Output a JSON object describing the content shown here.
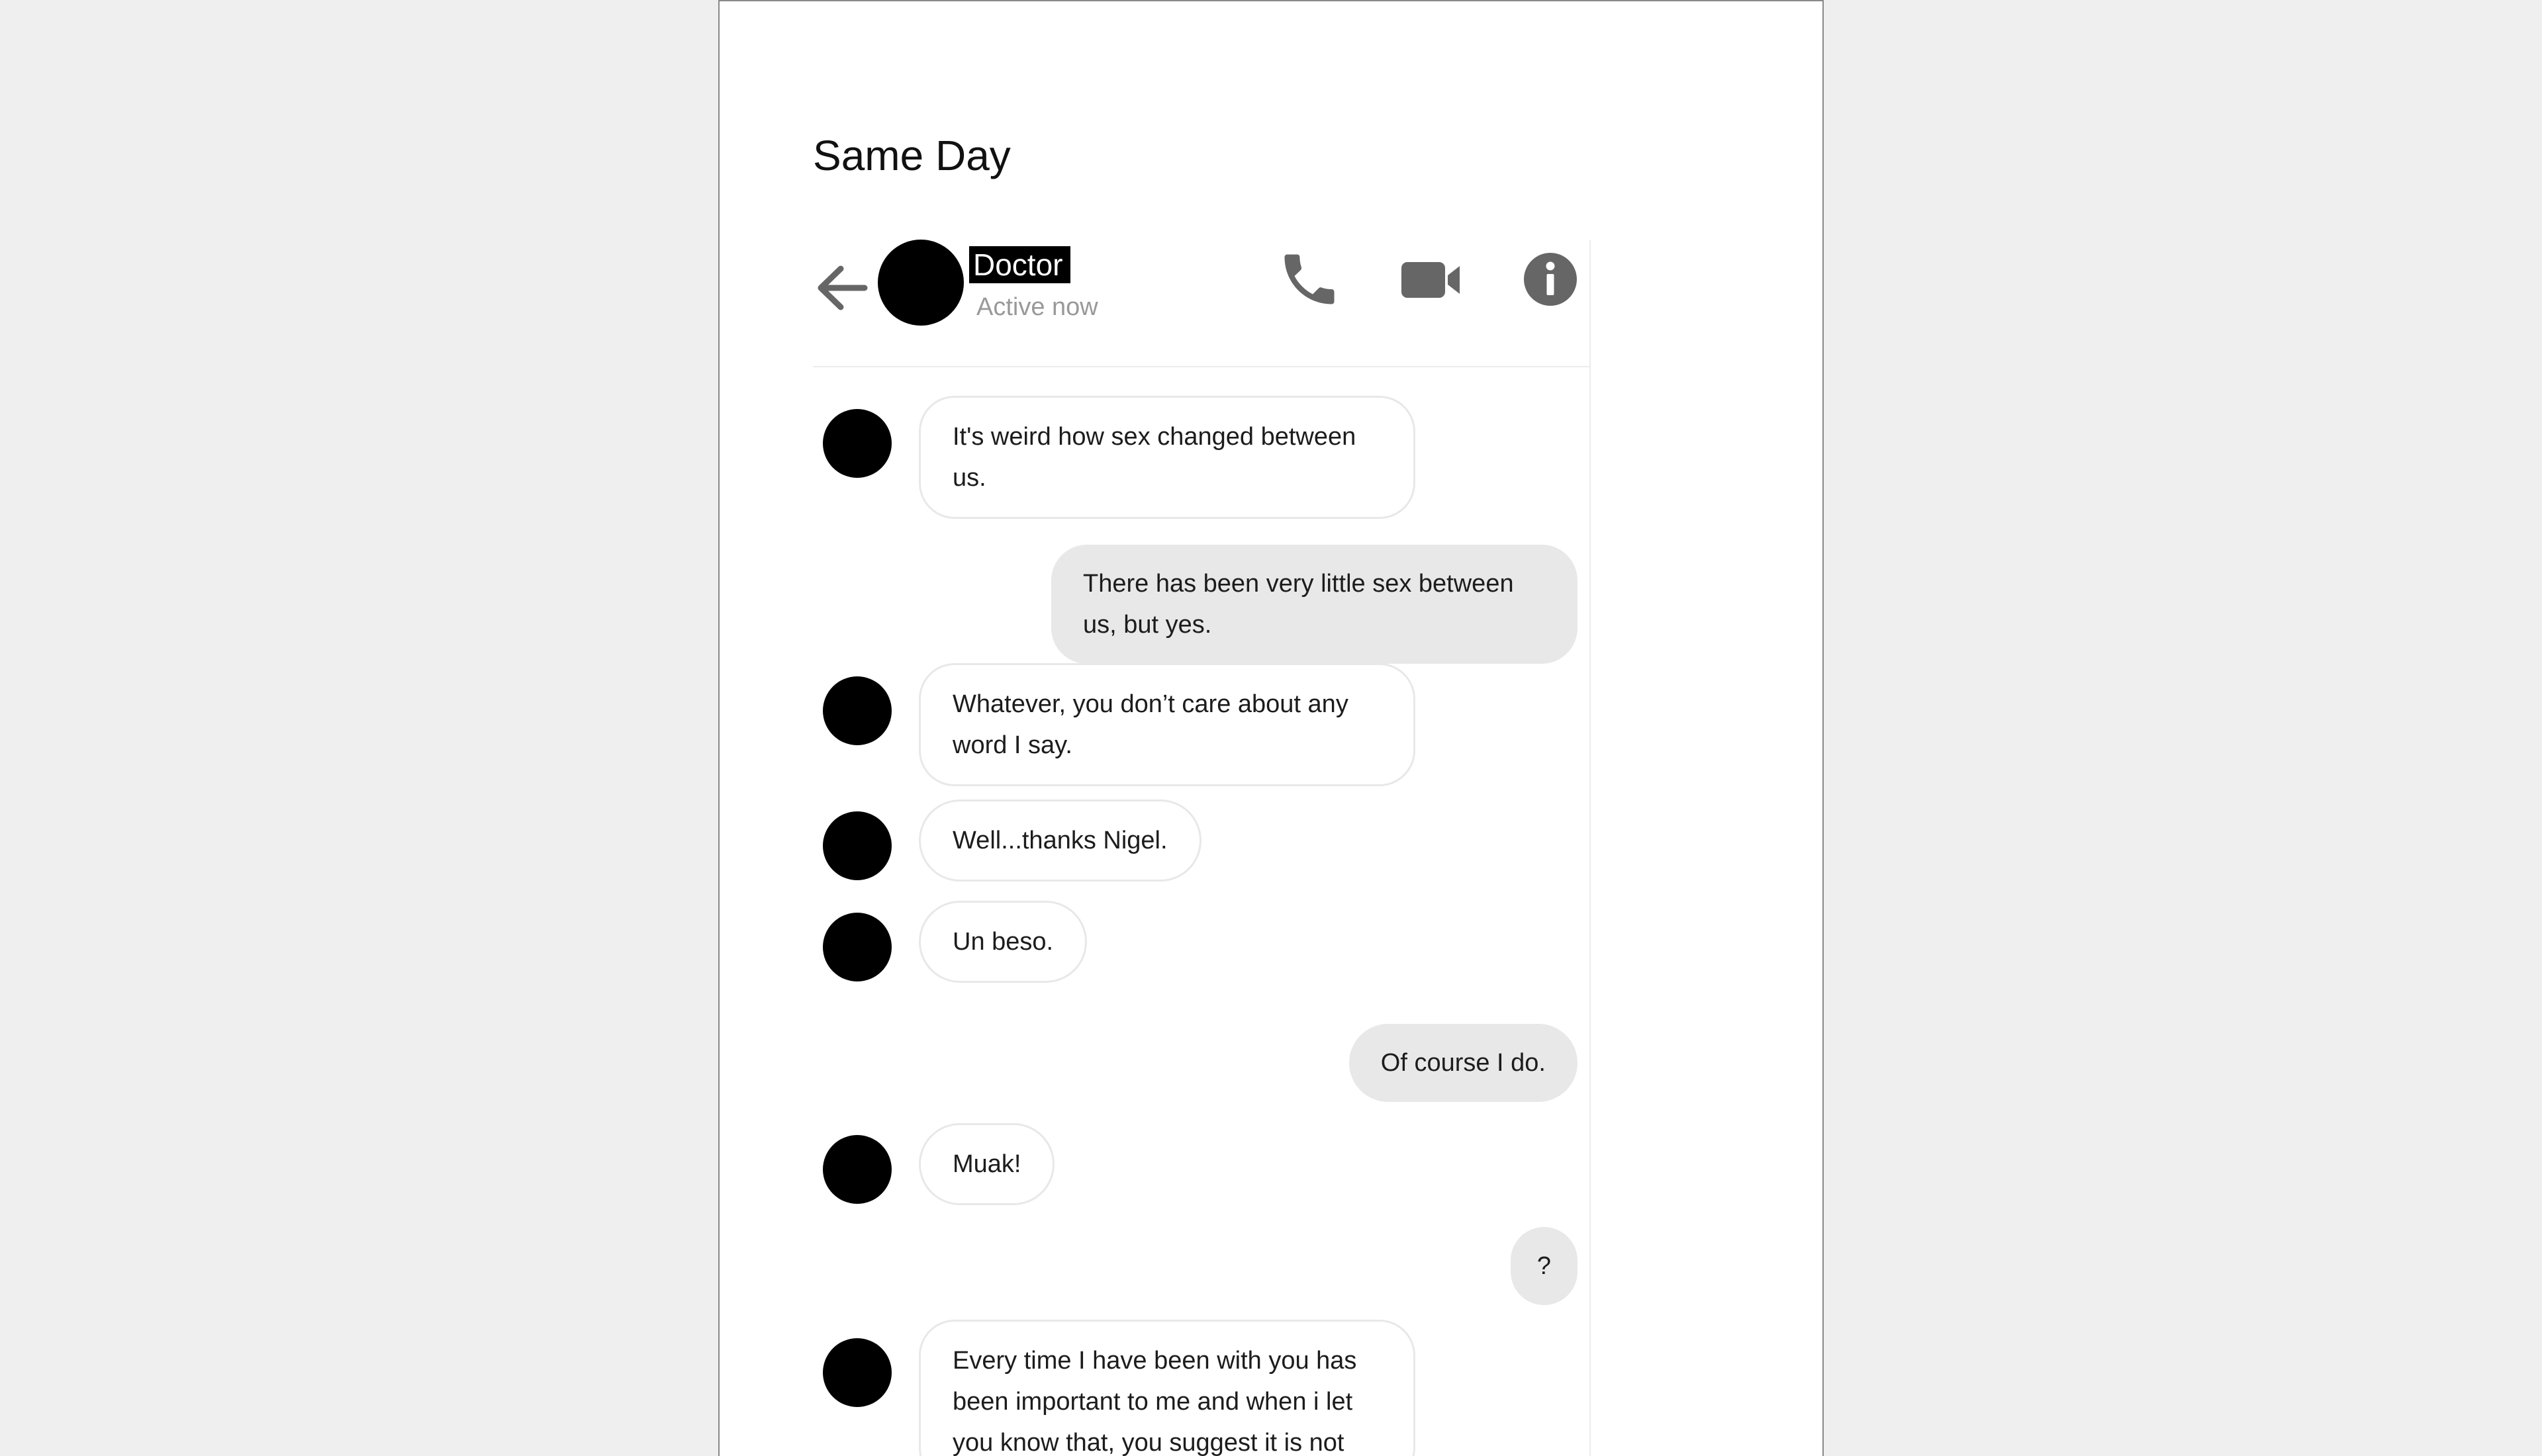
{
  "page": {
    "title": "Same Day"
  },
  "header": {
    "back_icon": "arrow-left-icon",
    "contact_name": "Doctor",
    "status": "Active now",
    "phone_icon": "phone-icon",
    "video_icon": "video-camera-icon",
    "info_icon": "info-icon"
  },
  "messages": [
    {
      "direction": "incoming",
      "text": "It's weird how sex changed between us."
    },
    {
      "direction": "outgoing",
      "text": "There has been very little sex between us, but yes."
    },
    {
      "direction": "incoming",
      "text": "Whatever, you don’t care about any word I say."
    },
    {
      "direction": "incoming",
      "text": "Well...thanks Nigel."
    },
    {
      "direction": "incoming",
      "text": "Un beso."
    },
    {
      "direction": "outgoing",
      "text": "Of course I do."
    },
    {
      "direction": "incoming",
      "text": "Muak!"
    },
    {
      "direction": "outgoing",
      "text": "?"
    },
    {
      "direction": "incoming",
      "text": "Every time I have been with you has been important to me and when i let you know that, you suggest it is not"
    }
  ],
  "colors": {
    "outgoing_bubble": "#e8e8e8",
    "incoming_border": "#e8e8e8",
    "icon_gray": "#666666",
    "status_gray": "#999999"
  }
}
